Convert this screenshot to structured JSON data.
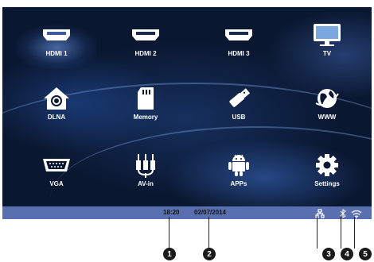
{
  "apps": [
    {
      "label": "HDMI 1",
      "icon": "hdmi-icon",
      "selected": true
    },
    {
      "label": "HDMI 2",
      "icon": "hdmi-icon",
      "selected": false
    },
    {
      "label": "HDMI 3",
      "icon": "hdmi-icon",
      "selected": false
    },
    {
      "label": "TV",
      "icon": "tv-icon",
      "selected": false
    },
    {
      "label": "DLNA",
      "icon": "dlna-icon",
      "selected": false
    },
    {
      "label": "Memory",
      "icon": "sd-card-icon",
      "selected": false
    },
    {
      "label": "USB",
      "icon": "usb-icon",
      "selected": false
    },
    {
      "label": "WWW",
      "icon": "globe-icon",
      "selected": false
    },
    {
      "label": "VGA",
      "icon": "vga-icon",
      "selected": false
    },
    {
      "label": "AV-in",
      "icon": "av-cable-icon",
      "selected": false
    },
    {
      "label": "APPs",
      "icon": "android-icon",
      "selected": false
    },
    {
      "label": "Settings",
      "icon": "gear-icon",
      "selected": false
    }
  ],
  "status": {
    "time": "18:20",
    "date": "02/07/2014",
    "icons": [
      "network-icon",
      "bluetooth-icon",
      "wifi-icon"
    ]
  },
  "callouts": [
    "1",
    "2",
    "3",
    "4",
    "5"
  ],
  "colors": {
    "statusbar": "#5a6fb0",
    "background": "#0a1730"
  }
}
